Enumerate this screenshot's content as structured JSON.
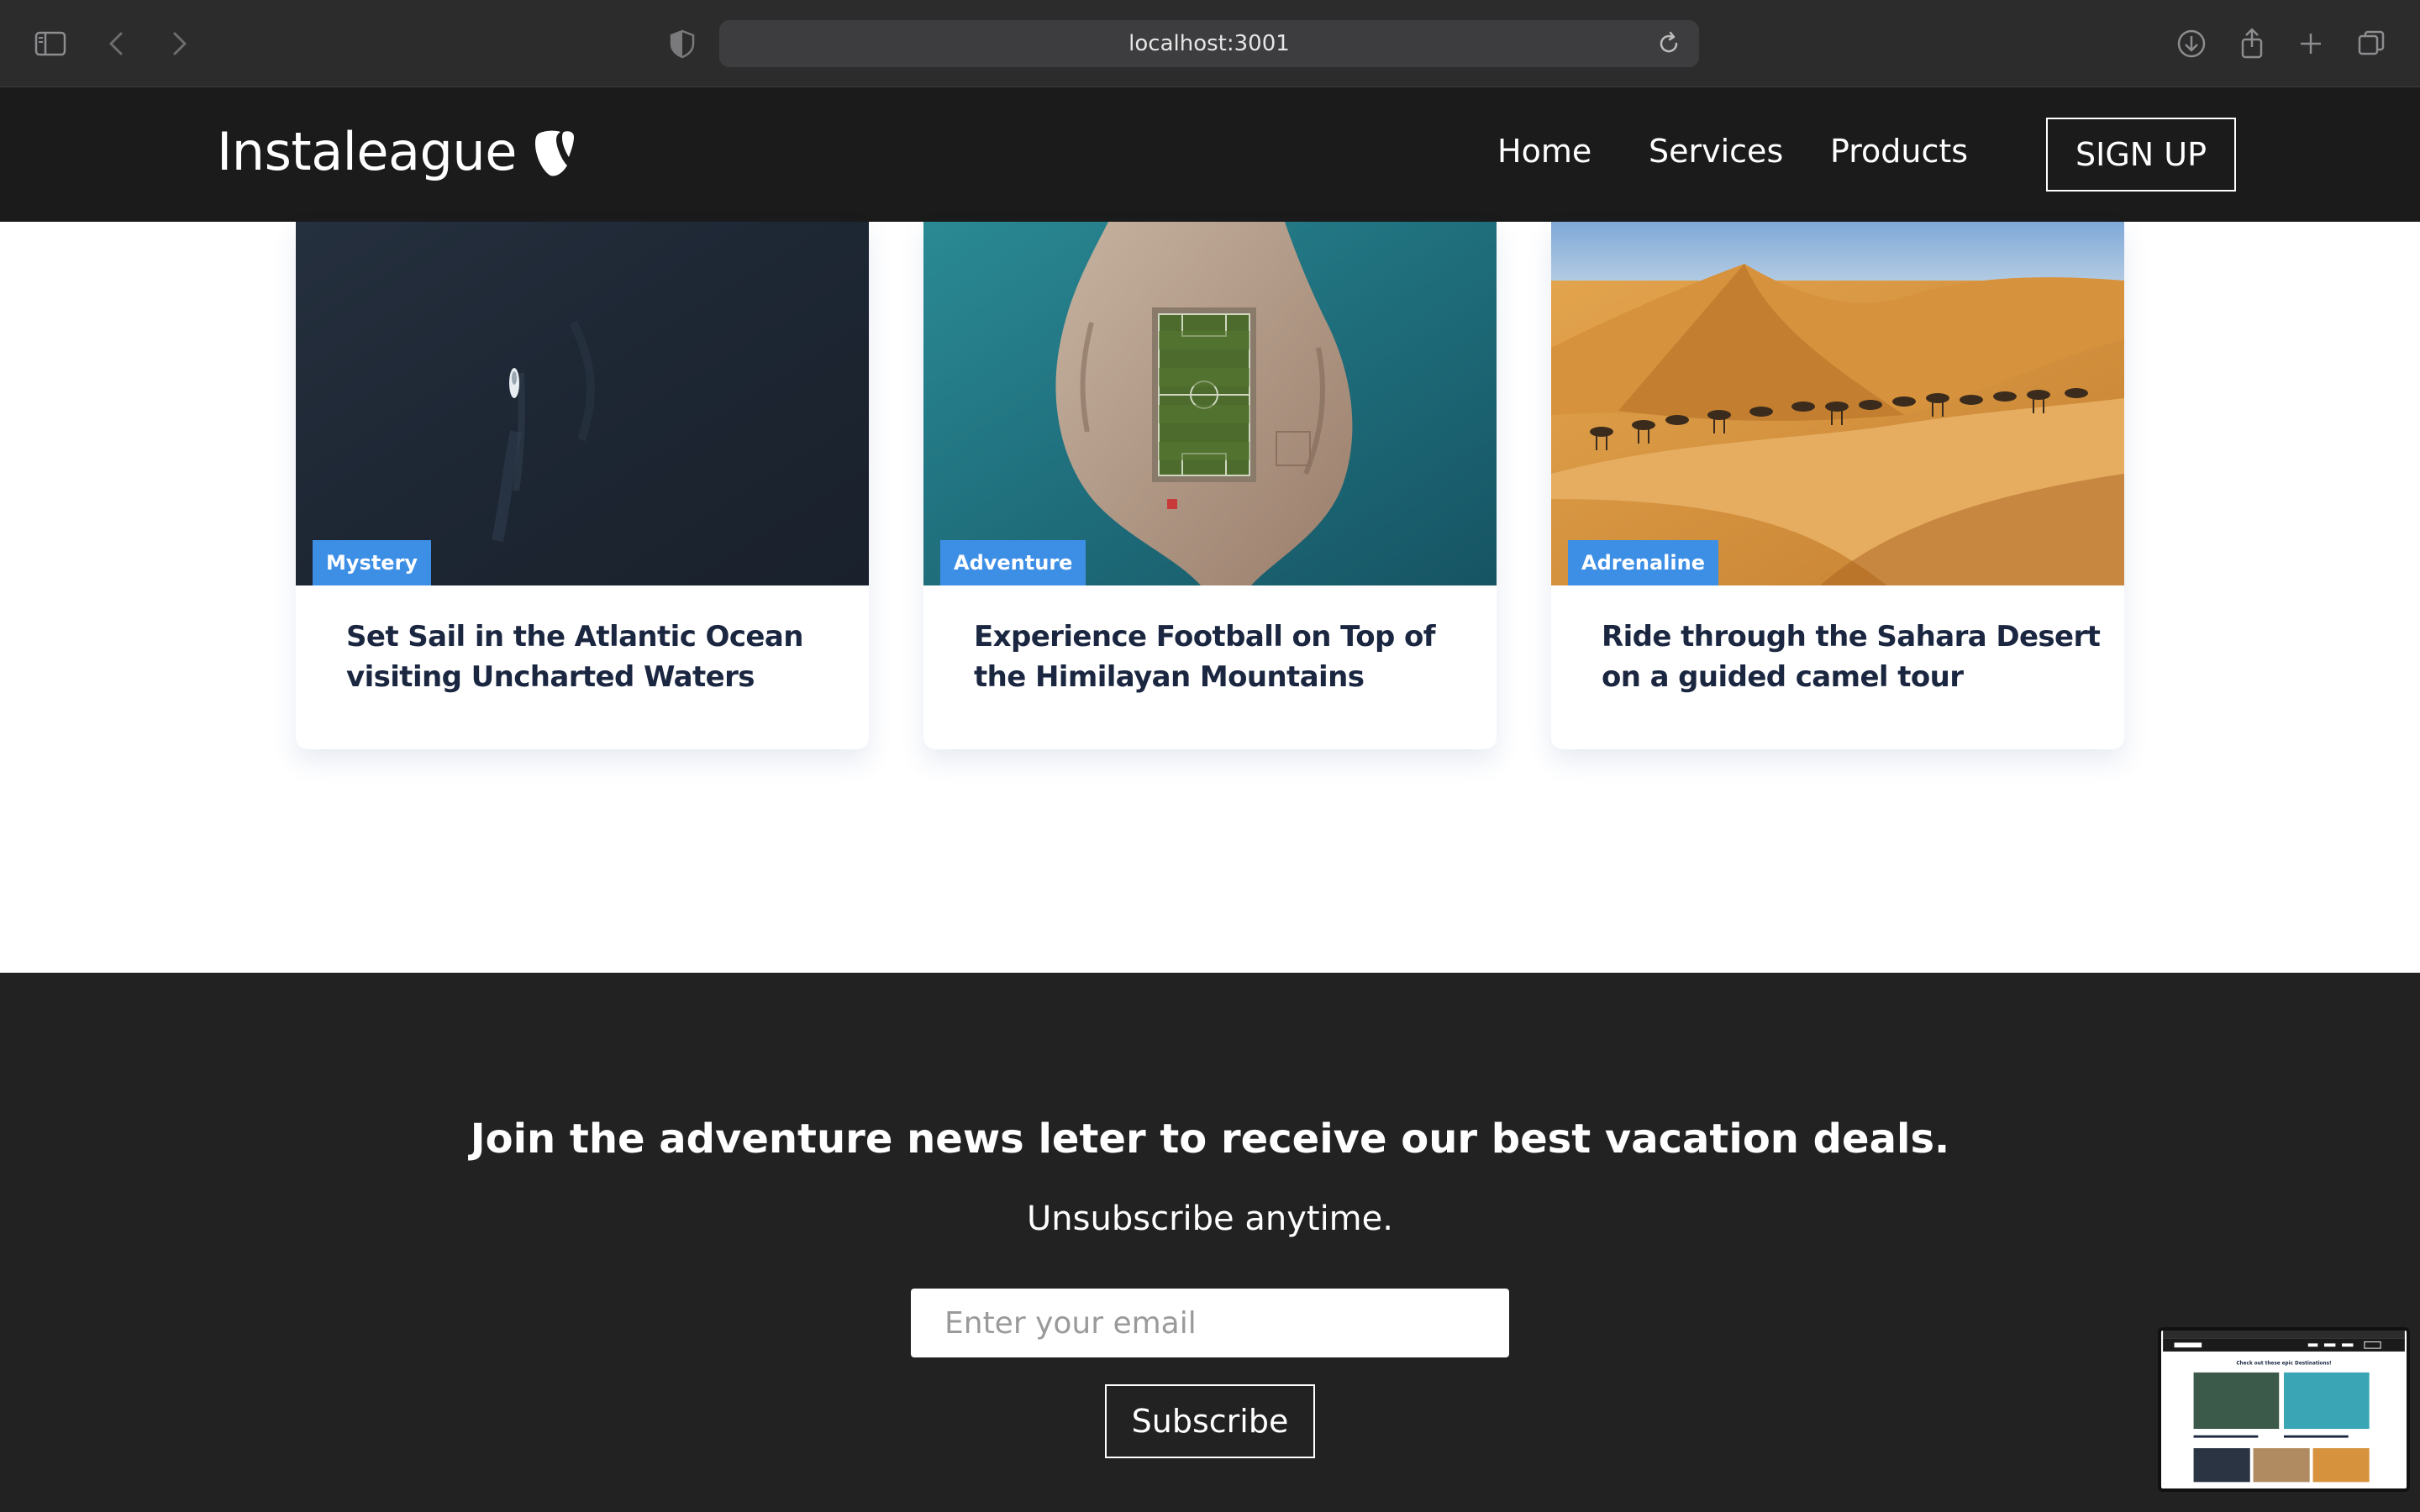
{
  "browser": {
    "url": "localhost:3001"
  },
  "header": {
    "logo_text": "Instaleague",
    "nav": [
      "Home",
      "Services",
      "Products"
    ],
    "signup_label": "SIGN UP"
  },
  "cards": [
    {
      "tag": "Mystery",
      "title": "Set Sail in the Atlantic Ocean visiting Uncharted Waters"
    },
    {
      "tag": "Adventure",
      "title": "Experience Football on Top of the Himilayan Mountains"
    },
    {
      "tag": "Adrenaline",
      "title": "Ride through the Sahara Desert on a guided camel tour"
    }
  ],
  "newsletter": {
    "title": "Join the adventure news leter to receive our best vacation deals.",
    "subtitle": "Unsubscribe anytime.",
    "email_placeholder": "Enter your email",
    "subscribe_label": "Subscribe"
  },
  "thumbnail": {
    "heading": "Check out these epic Destinations!"
  },
  "colors": {
    "header_bg": "#1b1b1b",
    "tag_bg": "#3d8fe6",
    "card_title": "#1b2741",
    "newsletter_bg": "#222222"
  }
}
